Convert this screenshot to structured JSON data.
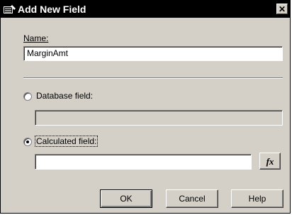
{
  "window": {
    "title": "Add New Field",
    "close_glyph": "✕"
  },
  "name_section": {
    "label": "Name:",
    "value": "MarginAmt"
  },
  "database_field": {
    "label": "Database field:",
    "selected": false,
    "value": ""
  },
  "calculated_field": {
    "label": "Calculated field:",
    "selected": true,
    "value": ""
  },
  "fx_button": {
    "label": "fx",
    "icon": "function-icon"
  },
  "buttons": {
    "ok": "OK",
    "cancel": "Cancel",
    "help": "Help"
  }
}
